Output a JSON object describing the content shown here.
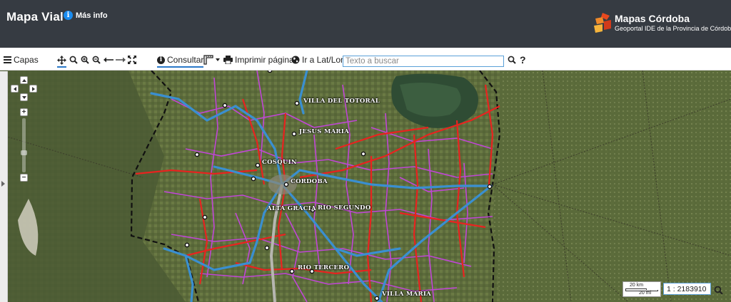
{
  "header": {
    "title": "Mapa Vial",
    "info_label": "Más info",
    "brand_name": "Mapas Córdoba",
    "brand_subtitle": "Geoportal IDE de la Provincia de Córdoba"
  },
  "toolbar": {
    "layers_label": "Capas",
    "query_label": "Consultar",
    "print_label": "Imprimir página",
    "goto_label": "Ir a Lat/Lon",
    "search_placeholder": "Texto a buscar",
    "help_label": "?"
  },
  "map": {
    "city_labels": {
      "villa_del_totoral": "VILLA DEL TOTORAL",
      "jesus_maria": "JESUS MARIA",
      "cosquin": "COSQUIN",
      "cordoba": "CORDOBA",
      "alta_gracia": "ALTA GRACIA",
      "rio_segundo": "RIO SEGUNDO",
      "rio_tercero": "RIO TERCERO",
      "villa_maria": "VILLA MARIA"
    },
    "zoom_in_label": "+",
    "zoom_out_label": "−",
    "scale_km": "20 km",
    "scale_mi": "20 mi",
    "scale_value": "1 : 2183910"
  },
  "colors": {
    "header_bg": "#363b42",
    "accent": "#2a78c8",
    "info_icon": "#1a8cf0",
    "road_national": "#e8231f",
    "road_provincial": "#c046d6",
    "highway": "#3a8fd0",
    "boundary": "#111111"
  }
}
